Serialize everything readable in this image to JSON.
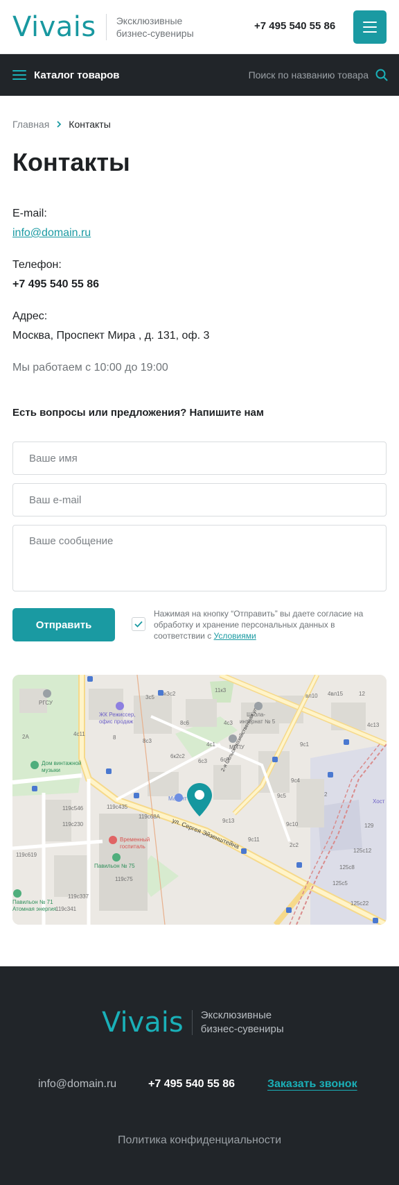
{
  "header": {
    "logo": "Vivais",
    "tagline_line1": "Эксклюзивные",
    "tagline_line2": "бизнес-сувениры",
    "phone": "+7 495 540 55 86"
  },
  "catalog_bar": {
    "catalog_label": "Каталог товаров",
    "search_placeholder": "Поиск по названию товара"
  },
  "breadcrumb": {
    "home": "Главная",
    "current": "Контакты"
  },
  "page": {
    "title": "Контакты"
  },
  "contacts": {
    "email_label": "E-mail:",
    "email": "info@domain.ru",
    "phone_label": "Телефон:",
    "phone": "+7 495 540 55 86",
    "address_label": "Адрес:",
    "address": "Москва, Проспект Мира , д. 131, оф. 3",
    "hours": "Мы работаем с 10:00 до 19:00"
  },
  "form": {
    "title": "Есть вопросы или предложения? Напишите нам",
    "name_placeholder": "Ваше имя",
    "email_placeholder": "Ваш e-mail",
    "message_placeholder": "Ваше сообщение",
    "submit_label": "Отправить",
    "consent_checked": true,
    "consent_text": "Нажимая на кнопку “Отправить” вы даете согласие на обработку и хранение персональных данных в соответствии с",
    "consent_link": "Условиями"
  },
  "map": {
    "labels": {
      "rgsu": "РГСУ",
      "jk": "ЖК Режиссер,",
      "jk2": "офис продаж",
      "school": "Школа-",
      "school2": "интернат № 5",
      "mgpu": "МГПУ",
      "dom": "Дом винтажной",
      "dom2": "музыки",
      "magnit": "Магнит",
      "street": "ул. Сергея Эйзенштейна",
      "street2": "2-я Сельскохозяйственная ул.",
      "hospital": "Временный",
      "hospital2": "госпиталь",
      "pavilion": "Павильон № 75",
      "pavilion71": "Павильон № 71",
      "energy": "Атомная энергия",
      "b3c5": "3с5",
      "b13c2": "13к3с2",
      "b11k3": "11к3",
      "b4c3": "4с3",
      "b8c6": "8с6",
      "b4c11": "4с11",
      "b8": "8",
      "b8c3": "8с3",
      "b6c2c2": "6к2с2",
      "b4c1": "4с1",
      "b6c3": "6с3",
      "b6c9": "6с9",
      "b9c1": "9с1",
      "b9c4": "9с4",
      "b9c5": "9с5",
      "b2": "2",
      "b9c10": "9с10",
      "b9c13": "9с13",
      "b9c11": "9с11",
      "b2c2": "2с2",
      "b129": "129",
      "b125c12": "125с12",
      "b125c8": "125с8",
      "b125c5": "125с5",
      "b125c22": "125с22",
      "b119c546": "119с546",
      "b119c435": "119с435",
      "b119c68a": "119с68А",
      "b119c230": "119с230",
      "b119c619": "119с619",
      "b119c75": "119с75",
      "b119c337": "119с337",
      "b119c341": "119с341",
      "b2a": "2А",
      "b4c13": "4с13",
      "b4015": "4вл15",
      "b10": "вл10",
      "host": "Хост",
      "b12": "12"
    }
  },
  "footer": {
    "logo": "Vivais",
    "tagline_line1": "Эксклюзивные",
    "tagline_line2": "бизнес-сувениры",
    "email": "info@domain.ru",
    "phone": "+7 495 540 55 86",
    "callback": "Заказать звонок",
    "policy": "Политика конфиденциальности"
  },
  "colors": {
    "accent": "#1a9aa2",
    "dark": "#212529",
    "text": "#1e2124",
    "muted": "#6f7478"
  }
}
